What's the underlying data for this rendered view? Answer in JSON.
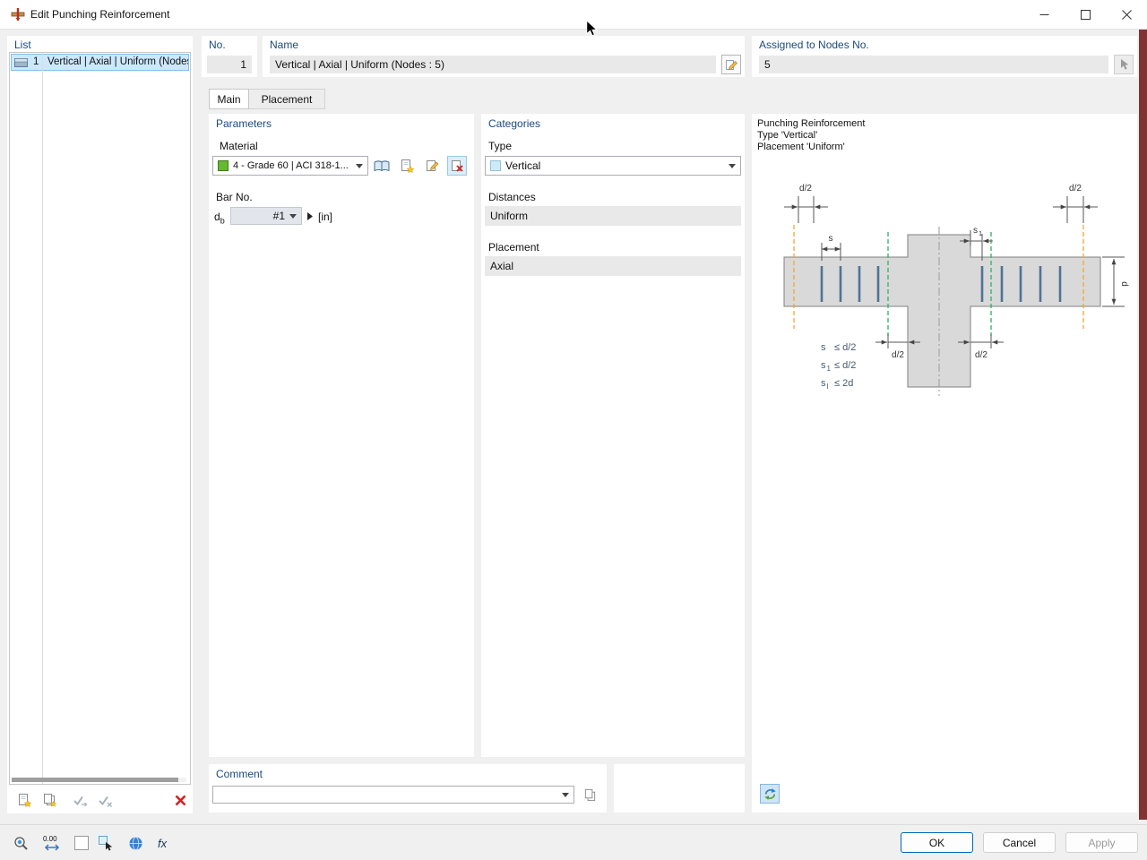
{
  "window": {
    "title": "Edit Punching Reinforcement"
  },
  "list": {
    "header": "List",
    "item": {
      "no": "1",
      "label": "Vertical | Axial | Uniform (Nodes :"
    }
  },
  "header_fields": {
    "no_label": "No.",
    "no_value": "1",
    "name_label": "Name",
    "name_value": "Vertical | Axial | Uniform (Nodes : 5)",
    "assigned_label": "Assigned to Nodes No.",
    "assigned_value": "5"
  },
  "tabs": {
    "main": "Main",
    "placement": "Placement"
  },
  "parameters": {
    "header": "Parameters",
    "material_label": "Material",
    "material_value": "4 - Grade 60 | ACI 318-1...",
    "bar_label": "Bar No.",
    "bar_symbol": "d",
    "bar_symbol_sub": "b",
    "bar_value": "#1",
    "bar_unit": "[in]"
  },
  "categories": {
    "header": "Categories",
    "type_label": "Type",
    "type_value": "Vertical",
    "distances_label": "Distances",
    "distances_value": "Uniform",
    "placement_label": "Placement",
    "placement_value": "Axial"
  },
  "preview": {
    "line1": "Punching Reinforcement",
    "line2": "Type 'Vertical'",
    "line3": "Placement 'Uniform'"
  },
  "diagram": {
    "d2_top_left": "d/2",
    "d2_top_right": "d/2",
    "d2_bottom_left": "d/2",
    "d2_bottom_right": "d/2",
    "s": "s",
    "s1": "s",
    "s1_sub": "1",
    "d": "d",
    "ineq": [
      {
        "lhs": "s",
        "sub": "",
        "rhs": "≤ d/2"
      },
      {
        "lhs": "s",
        "sub": "1",
        "rhs": "≤ d/2"
      },
      {
        "lhs": "s",
        "sub": "l",
        "rhs": "≤ 2d"
      }
    ]
  },
  "comment": {
    "header": "Comment",
    "value": ""
  },
  "buttons": {
    "ok": "OK",
    "cancel": "Cancel",
    "apply": "Apply"
  },
  "statusbar": {
    "decimals": "0.00",
    "fx": "fx"
  },
  "colors": {
    "selection": "#cce8ff",
    "label_navy": "#1b4a7e",
    "ok_border": "#0067c0",
    "material_swatch": "#66b82e",
    "type_swatch": "#cfeaf6",
    "outer_perimeter_dash": "#f0a830",
    "inner_perimeter_dash": "#2eaf6e",
    "rebar": "#4f7396",
    "right_strip": "#803333",
    "delete_red": "#d42020"
  }
}
